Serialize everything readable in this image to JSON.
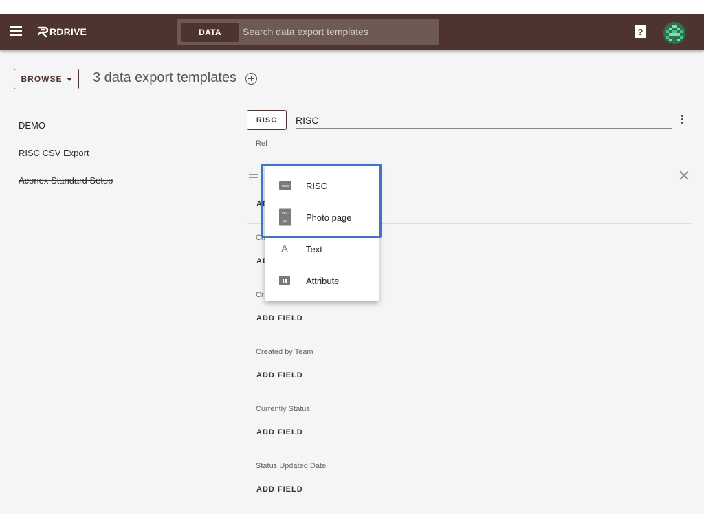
{
  "header": {
    "logo_text": "RDRIVE",
    "search_tab": "DATA",
    "search_placeholder": "Search data export templates",
    "help_symbol": "?"
  },
  "toolbar": {
    "browse_label": "BROWSE",
    "title": "3 data export templates"
  },
  "templates": [
    {
      "name": "DEMO",
      "struck": false
    },
    {
      "name": "RISC CSV Export",
      "struck": true
    },
    {
      "name": "Aconex Standard Setup",
      "struck": true
    }
  ],
  "editor": {
    "type_chip": "RISC",
    "template_name": "RISC",
    "ref_label": "Ref",
    "sections": [
      {
        "label": "Ch",
        "add_label": "ADD FIELD"
      },
      {
        "label": "Cr",
        "add_label": "ADD FIELD"
      },
      {
        "label": "Created by Team",
        "add_label": "ADD FIELD"
      },
      {
        "label": "Currently Status",
        "add_label": "ADD FIELD"
      },
      {
        "label": "Status Updated Date",
        "add_label": "ADD FIELD"
      }
    ],
    "ref_add_label": "AD"
  },
  "dropdown": {
    "items": [
      {
        "label": "RISC",
        "icon": "risc-icon",
        "icon_text": "RISC"
      },
      {
        "label": "Photo page",
        "icon": "risc-pp-icon",
        "icon_text_top": "RISC",
        "icon_text_bottom": "PP"
      },
      {
        "label": "Text",
        "icon": "text-icon",
        "icon_text": "A"
      },
      {
        "label": "Attribute",
        "icon": "attribute-icon"
      }
    ]
  },
  "colors": {
    "header_bg": "#4e342e",
    "highlight": "#3e74c9"
  }
}
